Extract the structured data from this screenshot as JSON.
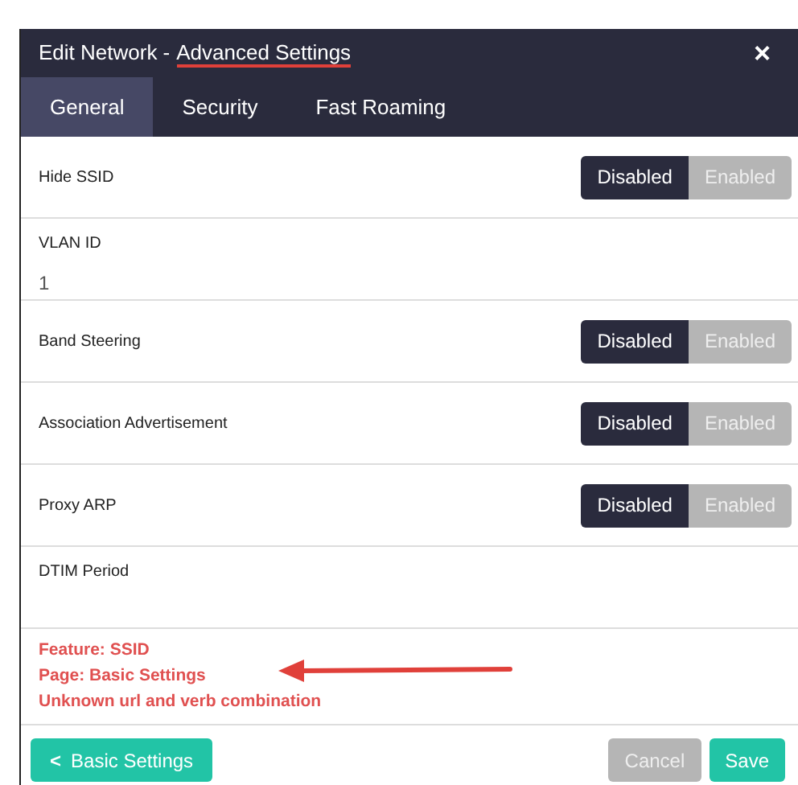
{
  "window": {
    "title": "Edit Network -",
    "title_highlight": "Advanced Settings",
    "close": "×"
  },
  "tabs": [
    {
      "label": "General",
      "selected": true
    },
    {
      "label": "Security",
      "selected": false
    },
    {
      "label": "Fast Roaming",
      "selected": false
    }
  ],
  "rows": [
    {
      "kind": "toggle",
      "label": "Hide SSID",
      "options": [
        {
          "label": "Disabled",
          "selected": true
        },
        {
          "label": "Enabled",
          "selected": false
        }
      ]
    },
    {
      "kind": "field",
      "label": "VLAN ID",
      "value": "1"
    },
    {
      "kind": "toggle",
      "label": "Band Steering",
      "options": [
        {
          "label": "Disabled",
          "selected": true
        },
        {
          "label": "Enabled",
          "selected": false
        }
      ]
    },
    {
      "kind": "toggle",
      "label": "Association Advertisement",
      "options": [
        {
          "label": "Disabled",
          "selected": true
        },
        {
          "label": "Enabled",
          "selected": false
        }
      ]
    },
    {
      "kind": "toggle",
      "label": "Proxy ARP",
      "options": [
        {
          "label": "Disabled",
          "selected": true
        },
        {
          "label": "Enabled",
          "selected": false
        }
      ]
    },
    {
      "kind": "field",
      "label": "DTIM Period"
    }
  ],
  "errors": [
    "Feature: SSID",
    "Page: Basic Settings",
    "Unknown url and verb combination"
  ],
  "footer": {
    "back": {
      "icon": "<",
      "label": "Basic Settings"
    },
    "buttons": [
      {
        "label": "Cancel",
        "disabled": true
      },
      {
        "label": "Save",
        "disabled": false
      }
    ]
  }
}
